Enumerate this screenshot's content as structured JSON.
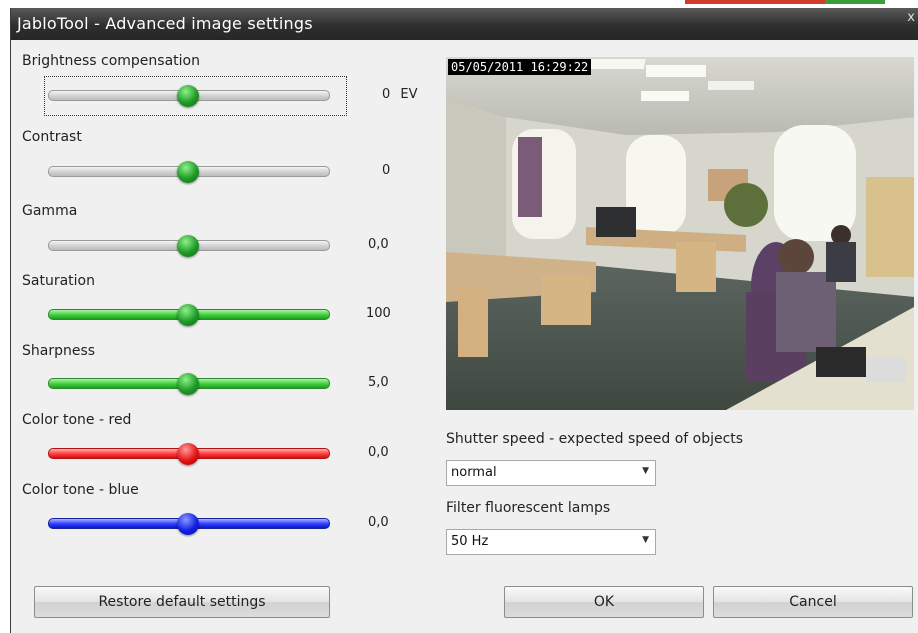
{
  "window": {
    "title": "JabloTool - Advanced image settings",
    "close_glyph": "x"
  },
  "settings": [
    {
      "label": "Brightness compensation",
      "value": "0",
      "unit": "EV",
      "position": 0.5,
      "track_color": "gray",
      "thumb_color": "green",
      "focused": true
    },
    {
      "label": "Contrast",
      "value": "0",
      "unit": "",
      "position": 0.5,
      "track_color": "gray",
      "thumb_color": "green"
    },
    {
      "label": "Gamma",
      "value": "0,0",
      "unit": "",
      "position": 0.5,
      "track_color": "gray",
      "thumb_color": "green"
    },
    {
      "label": "Saturation",
      "value": "100",
      "unit": "",
      "position": 0.5,
      "track_color": "green",
      "thumb_color": "green"
    },
    {
      "label": "Sharpness",
      "value": "5,0",
      "unit": "",
      "position": 0.5,
      "track_color": "green",
      "thumb_color": "green"
    },
    {
      "label": "Color tone - red",
      "value": "0,0",
      "unit": "",
      "position": 0.5,
      "track_color": "red",
      "thumb_color": "red"
    },
    {
      "label": "Color tone - blue",
      "value": "0,0",
      "unit": "",
      "position": 0.5,
      "track_color": "blue",
      "thumb_color": "blue"
    }
  ],
  "preview": {
    "timestamp": "05/05/2011 16:29:22"
  },
  "shutter": {
    "label": "Shutter speed - expected speed of objects",
    "value": "normal"
  },
  "filter": {
    "label": "Filter fluorescent lamps",
    "value": "50 Hz"
  },
  "buttons": {
    "restore": "Restore default settings",
    "ok": "OK",
    "cancel": "Cancel"
  },
  "colors": {
    "titlebar": "#2f2f2f",
    "dialog_bg": "#f0f0f0"
  }
}
